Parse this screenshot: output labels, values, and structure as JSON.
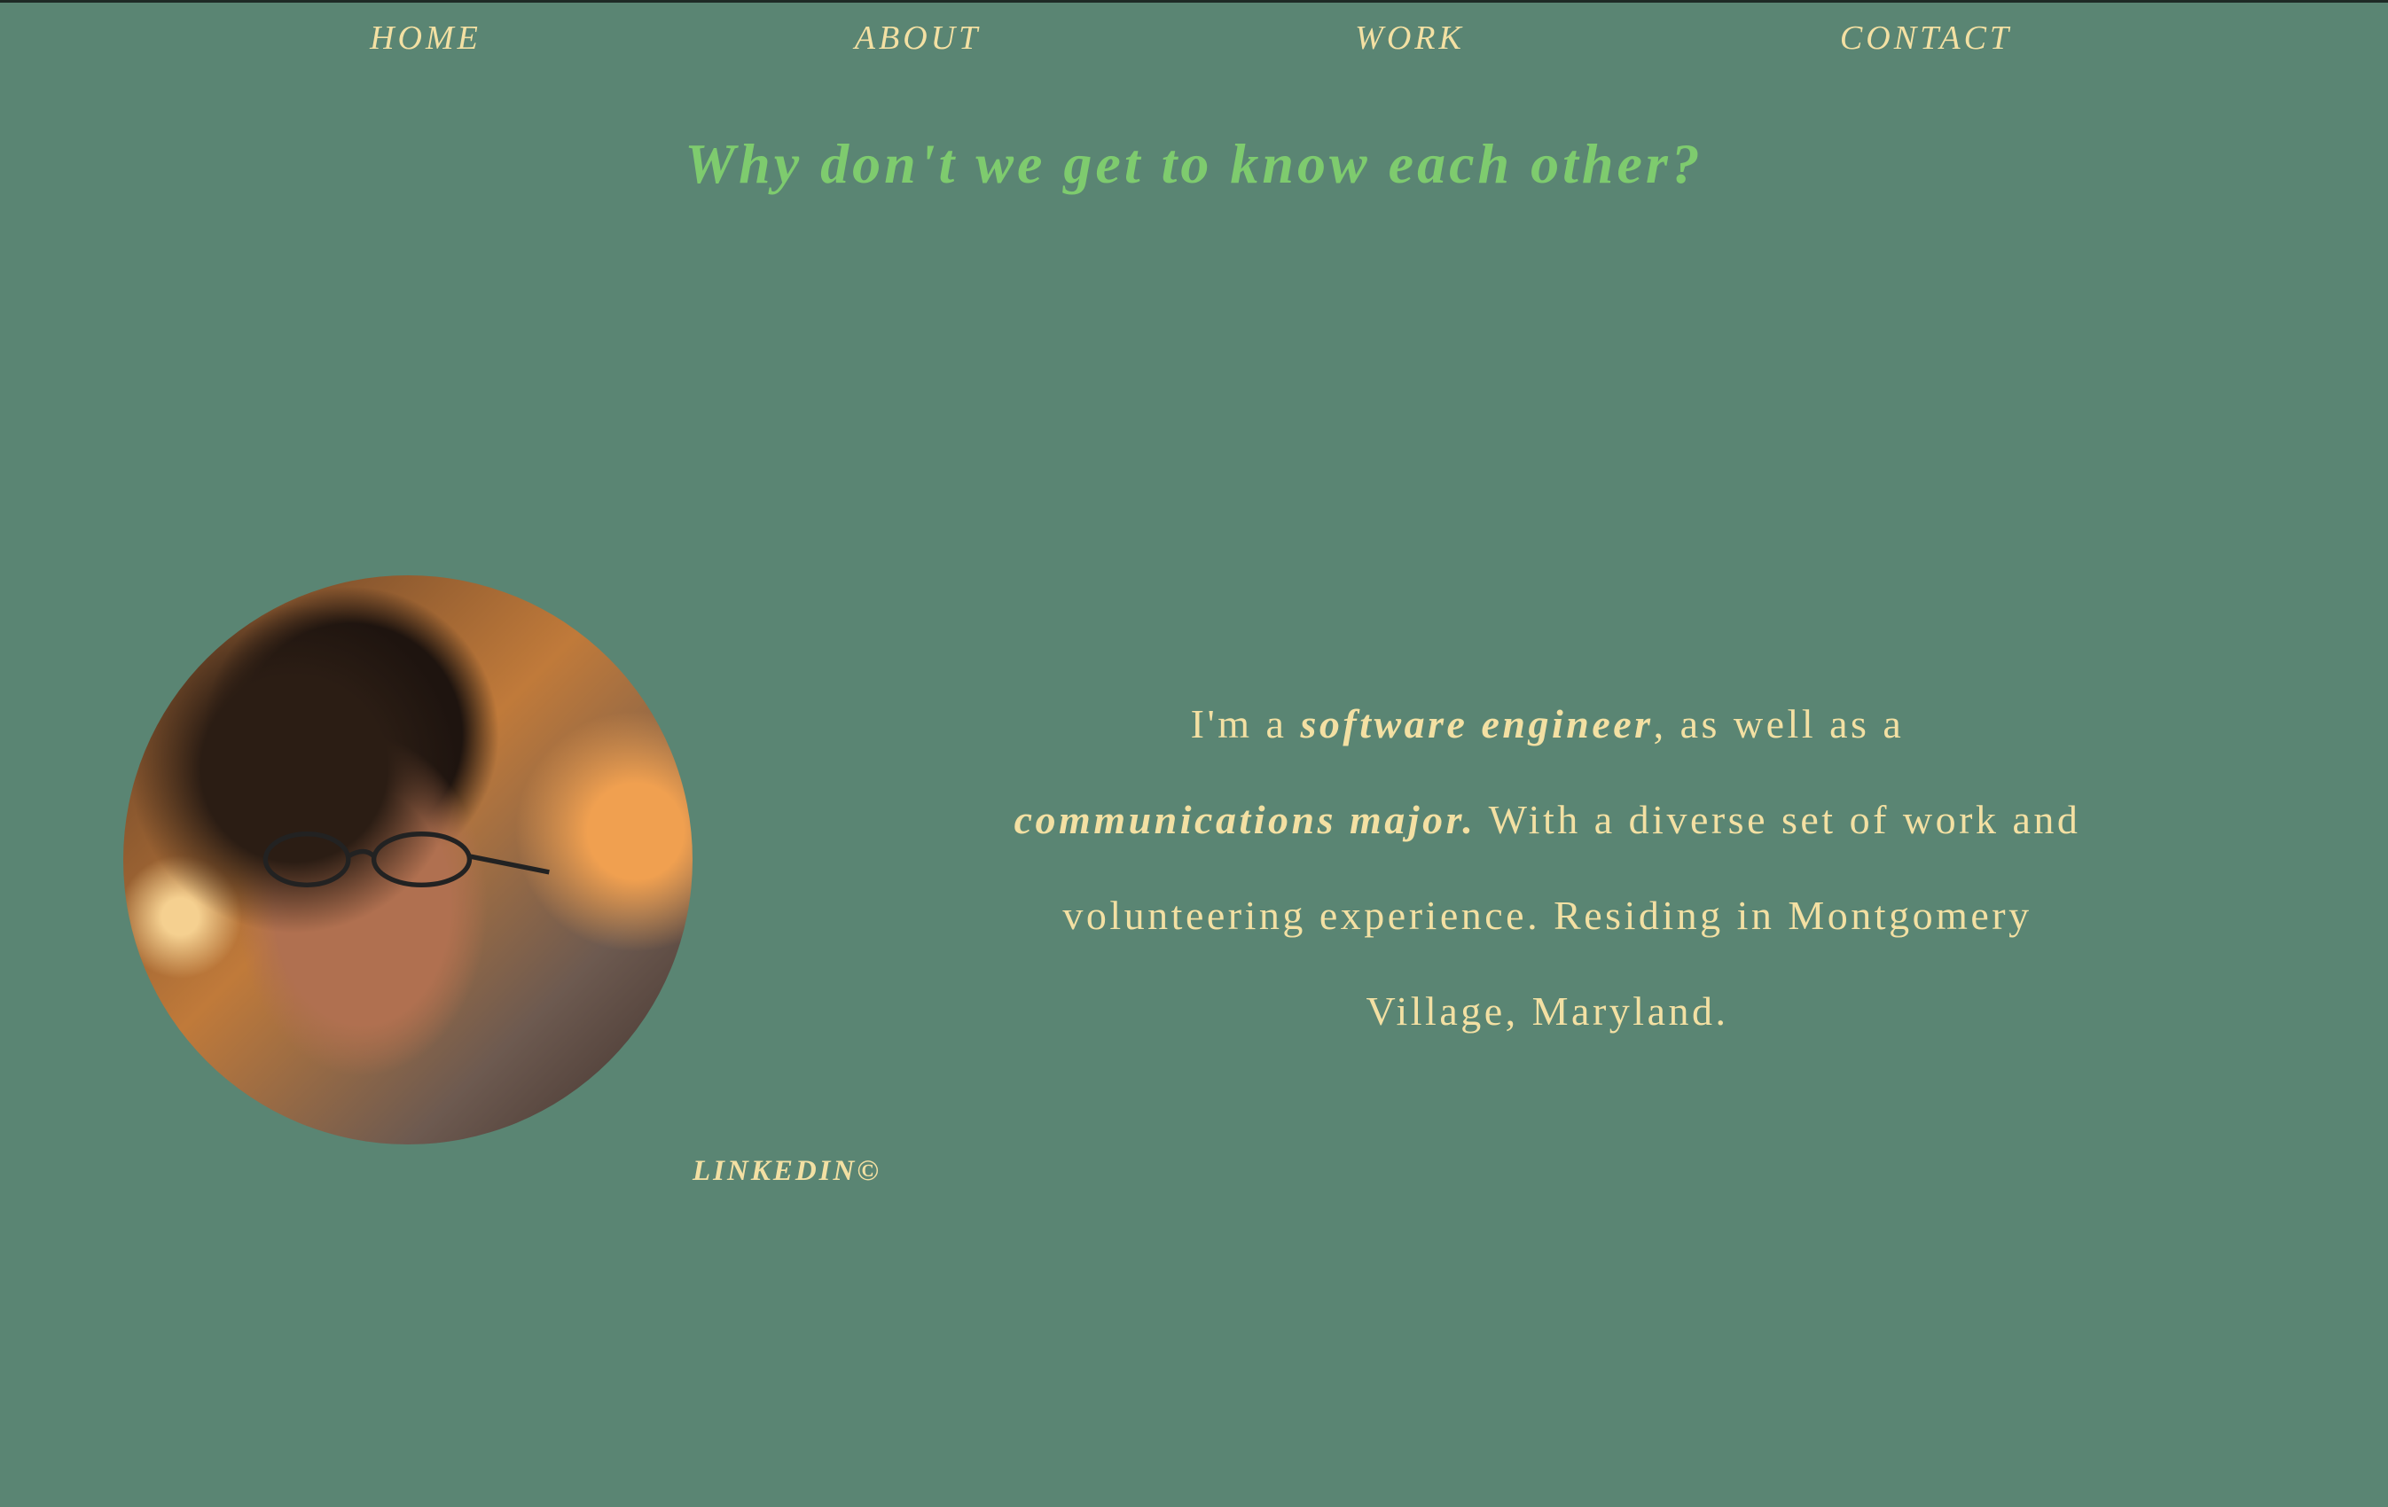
{
  "nav": {
    "items": [
      {
        "label": "HOME"
      },
      {
        "label": "ABOUT"
      },
      {
        "label": "WORK"
      },
      {
        "label": "CONTACT"
      }
    ]
  },
  "title": "Why don't we get to know each other?",
  "about": {
    "p1": "I'm a ",
    "em1": "software engineer",
    "p2": ", as well as a ",
    "em2": "communications major.",
    "p3": " With a diverse set of work and volunteering experience. Residing in Montgomery Village, Maryland."
  },
  "linkedin_label": "LINKEDIN©",
  "colors": {
    "background": "#5a8573",
    "text": "#f3e0a3",
    "title": "#7ecb6e"
  }
}
